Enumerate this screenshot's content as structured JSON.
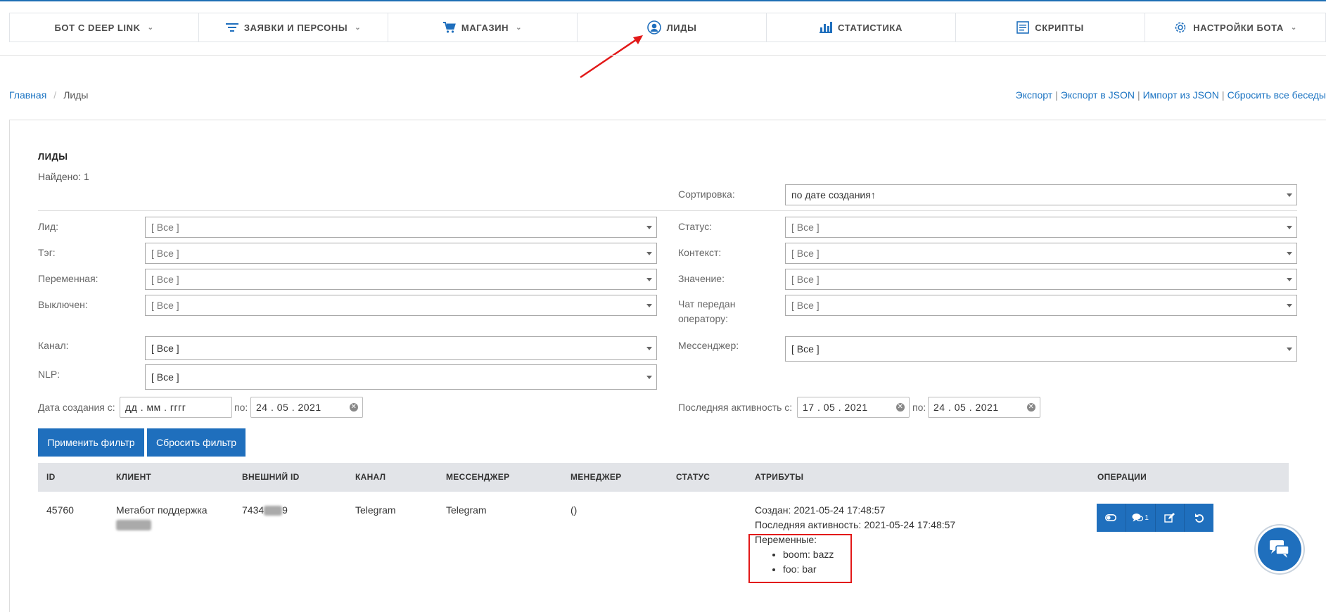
{
  "nav": [
    {
      "label": "БОТ С DEEP LINK",
      "icon": "",
      "chevron": true
    },
    {
      "label": "ЗАЯВКИ И ПЕРСОНЫ",
      "icon": "filter-icon",
      "chevron": true
    },
    {
      "label": "МАГАЗИН",
      "icon": "cart-icon",
      "chevron": true
    },
    {
      "label": "ЛИДЫ",
      "icon": "user-icon",
      "chevron": false
    },
    {
      "label": "СТАТИСТИКА",
      "icon": "bar-chart-icon",
      "chevron": false
    },
    {
      "label": "СКРИПТЫ",
      "icon": "document-icon",
      "chevron": false
    },
    {
      "label": "НАСТРОЙКИ БОТА",
      "icon": "gear-icon",
      "chevron": true
    }
  ],
  "breadcrumb": {
    "home": "Главная",
    "current": "Лиды"
  },
  "top_links": {
    "export": "Экспорт",
    "export_json": "Экспорт в JSON",
    "import_json": "Импорт из JSON",
    "reset_chats": "Сбросить все беседы"
  },
  "panel": {
    "title": "ЛИДЫ",
    "found": "Найдено: 1"
  },
  "sort": {
    "label": "Сортировка:",
    "value": "по дате создания↑"
  },
  "filters": {
    "lead": {
      "label": "Лид:",
      "value": "[ Все ]"
    },
    "tag": {
      "label": "Тэг:",
      "value": "[ Все ]"
    },
    "variable": {
      "label": "Переменная:",
      "value": "[ Все ]"
    },
    "disabled": {
      "label": "Выключен:",
      "value": "[ Все ]"
    },
    "channel": {
      "label": "Канал:",
      "value": "[ Все ]"
    },
    "nlp": {
      "label": "NLP:",
      "value": "[ Все ]"
    },
    "status": {
      "label": "Статус:",
      "value": "[ Все ]"
    },
    "context": {
      "label": "Контекст:",
      "value": "[ Все ]"
    },
    "value": {
      "label": "Значение:",
      "value": "[ Все ]"
    },
    "operator_line1": "Чат передан",
    "operator_line2": "оператору:",
    "operator_value": "[ Все ]",
    "messenger": {
      "label": "Мессенджер:",
      "value": "[ Все ]"
    }
  },
  "dates": {
    "created_label": "Дата создания с:",
    "created_from": "дд . мм . гггг",
    "to_label": "по:",
    "created_to": "24 . 05 . 2021",
    "activity_label": "Последняя активность с:",
    "activity_from": "17 . 05 . 2021",
    "activity_to": "24 . 05 . 2021"
  },
  "buttons": {
    "apply": "Применить фильтр",
    "reset": "Сбросить фильтр"
  },
  "table": {
    "headers": {
      "id": "ID",
      "client": "КЛИЕНТ",
      "ext_id": "ВНЕШНИЙ ID",
      "channel": "КАНАЛ",
      "messenger": "МЕССЕНДЖЕР",
      "manager": "МЕНЕДЖЕР",
      "status": "СТАТУС",
      "attributes": "АТРИБУТЫ",
      "operations": "ОПЕРАЦИИ"
    },
    "row": {
      "id": "45760",
      "client": "Метабот поддержка",
      "ext_id_start": "7434",
      "ext_id_end": "9",
      "channel": "Telegram",
      "messenger": "Telegram",
      "manager": "()",
      "status": "",
      "created": "Создан: 2021-05-24 17:48:57",
      "last_activity": "Последняя активность: 2021-05-24 17:48:57",
      "variables_label": "Переменные:",
      "variables": [
        "boom: bazz",
        "foo: bar"
      ],
      "chat_count": "1"
    }
  },
  "colors": {
    "accent": "#1f6fbd",
    "link": "#1a73c2",
    "highlight": "#e21818"
  }
}
